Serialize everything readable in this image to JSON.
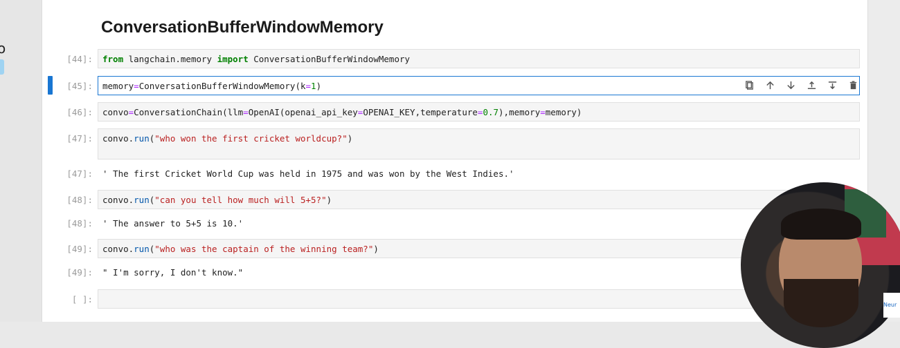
{
  "heading": "ConversationBufferWindowMemory",
  "cells": [
    {
      "prompt": "[44]:",
      "code": {
        "kw1": "from",
        "mod": " langchain.memory ",
        "kw2": "import",
        "name": " ConversationBufferWindowMemory"
      }
    },
    {
      "prompt": "[45]:",
      "code": {
        "var": "memory",
        "eq": "=",
        "call": "ConversationBufferWindowMemory(",
        "arg": "k",
        "eq2": "=",
        "num": "1",
        "close": ")"
      }
    },
    {
      "prompt": "[46]:",
      "code": {
        "var": "convo",
        "eq": "=",
        "a": "ConversationChain(llm",
        "eq2": "=",
        "b": "OpenAI(openai_api_key",
        "eq3": "=",
        "c": "OPENAI_KEY,temperature",
        "eq4": "=",
        "num": "0.7",
        "d": "),memory",
        "eq5": "=",
        "e": "memory)"
      }
    },
    {
      "prompt": "[47]:",
      "code": {
        "obj": "convo.",
        "fn": "run",
        "open": "(",
        "str": "\"who won the first cricket worldcup?\"",
        "close": ")"
      }
    },
    {
      "prompt": "[48]:",
      "code": {
        "obj": "convo.",
        "fn": "run",
        "open": "(",
        "str": "\"can you tell how much will 5+5?\"",
        "close": ")"
      }
    },
    {
      "prompt": "[49]:",
      "code": {
        "obj": "convo.",
        "fn": "run",
        "open": "(",
        "str": "\"who was the captain of the winning team?\"",
        "close": ")"
      }
    },
    {
      "prompt": "[ ]:"
    }
  ],
  "outputs": [
    {
      "prompt": "[47]:",
      "text": "' The first Cricket World Cup was held in 1975 and was won by the West Indies.'"
    },
    {
      "prompt": "[48]:",
      "text": "' The answer to 5+5 is 10.'"
    },
    {
      "prompt": "[49]:",
      "text": "\" I'm sorry, I don't know.\""
    }
  ],
  "toolbar": [
    "copy-icon",
    "arrow-up-icon",
    "arrow-down-icon",
    "insert-above-icon",
    "insert-below-icon",
    "trash-icon"
  ],
  "webcam_badge": "Neur",
  "colors": {
    "accent": "#1976d2",
    "keyword": "#008000",
    "string": "#ba2121",
    "operator": "#aa22ff"
  }
}
